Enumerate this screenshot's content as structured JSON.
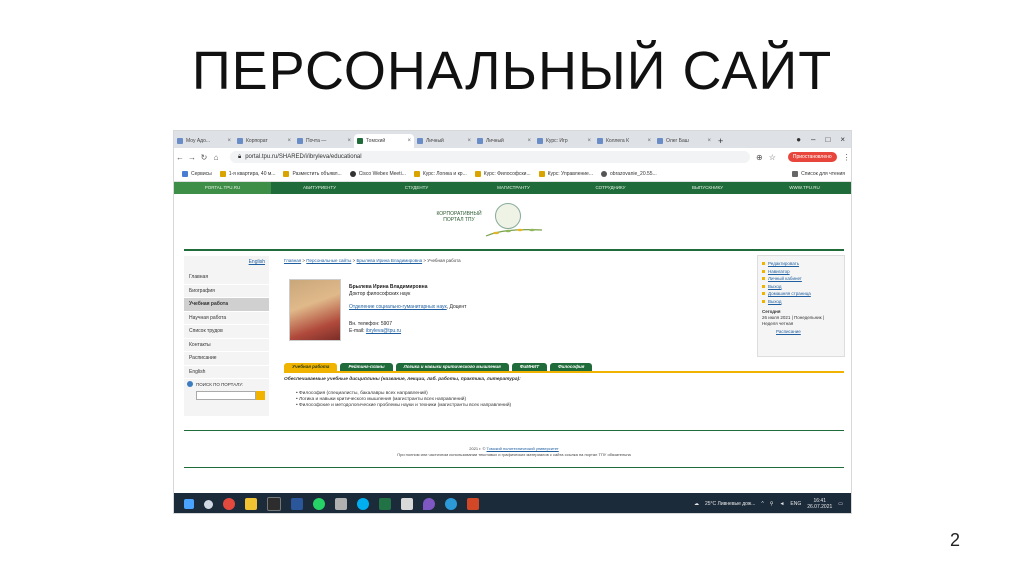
{
  "slide": {
    "title": "ПЕРСОНАЛЬНЫЙ САЙТ",
    "page_number": "2"
  },
  "browser": {
    "tabs": [
      "Моу Адо...",
      "Корпорат",
      "Почта —",
      "Томский",
      "Личный",
      "Личный",
      "Курс: Игр",
      "Коллега К",
      "Олег Баш"
    ],
    "active_tab_index": 3,
    "url": "portal.tpu.ru/SHARED/i/ibryleva/educational",
    "paused_label": "Приостановлено",
    "bookmarks": [
      "Сервисы",
      "1-я квартира, 40 м...",
      "Разместить объявл...",
      "Cisco Webex Meeti...",
      "Курс: Логика и кр...",
      "Курс: Философски...",
      "Курс: Управление...",
      "obrazovanie_20.55...",
      "Список для чтения"
    ]
  },
  "site": {
    "topnav": [
      "PORTAL.TPU.RU",
      "АБИТУРИЕНТУ",
      "СТУДЕНТУ",
      "МАГИСТРАНТУ",
      "СОТРУДНИКУ",
      "ВЫПУСКНИКУ",
      "WWW.TPU.RU"
    ],
    "logo_text": "КОРПОРАТИВНЫЙ ПОРТАЛ ТПУ",
    "english_link": "English",
    "sidebar": [
      "Главная",
      "Биография",
      "Учебная работа",
      "Научная работа",
      "Список трудов",
      "Контакты",
      "Расписание",
      "English"
    ],
    "sidebar_active_index": 2,
    "search_label": "ПОИСК ПО ПОРТАЛУ:",
    "breadcrumb": {
      "home": "Главная",
      "sep1": " > ",
      "sites": "Персональные сайты",
      "sep2": " > ",
      "person": "Брылева Ирина Владимировна",
      "tail": " > Учебная работа"
    },
    "person": {
      "name": "Брылева Ирина Владимировна",
      "degree": "Доктор философских наук",
      "department_link": "Отделение социально-гуманитарных наук",
      "position": ", Доцент",
      "phone": "Вн. телефон: 5907",
      "email_label": "E-mail: ",
      "email": "ibryleva@tpu.ru"
    },
    "right_links": [
      "Редактировать",
      "Навигатор",
      "Личный кабинет",
      "Выход",
      "Домашняя страница",
      "Выход"
    ],
    "today": {
      "label": "Сегодня",
      "date": "26 июля 2021 | Понедельник |",
      "week": "Неделя четная",
      "schedule_link": "Расписание"
    },
    "content_tabs": [
      "Учебная работа",
      "Рейтинг-планы",
      "Логика и навыки критического мышления",
      "ФиМНИТ",
      "Философия"
    ],
    "content_tab_active_index": 0,
    "disciplines_heading": "Обеспечиваемые учебные дисциплины (название, лекции, лаб. работы, практика, литература):",
    "courses": [
      "Философия (специалисты, бакалавры всех направлений)",
      "Логика и навыки критического мышления (магистранты всех направлений)",
      "Философские и методологические проблемы науки и техники (магистранты всех направлений)"
    ],
    "footer": {
      "copyright": "2021 г. © ",
      "university_link": "Томский политехнический университет",
      "notice": "При полном или частичном использовании текстовых и графических материалов с сайта ссылка на портал ТПУ обязательна"
    }
  },
  "taskbar": {
    "weather": "25°C  Ливневые дож...",
    "lang": "ENG",
    "time": "16:41",
    "date": "26.07.2021"
  }
}
